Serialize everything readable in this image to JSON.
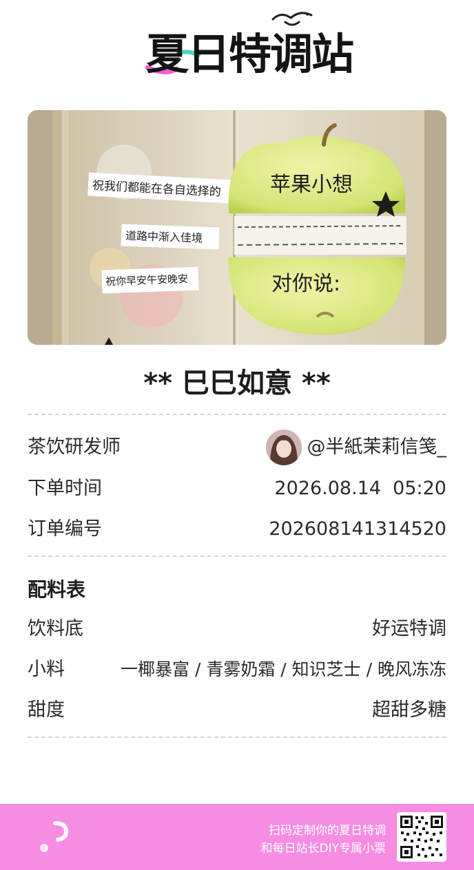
{
  "header": {
    "logo_text": "夏日特调站"
  },
  "hero": {
    "photo_notes": [
      "祝我们都能在各自选择的",
      "道路中渐入佳境",
      "祝你早安午安晚安",
      "苹果小想",
      "对你说:"
    ]
  },
  "drink": {
    "title": "** 巳巳如意 **"
  },
  "order": {
    "creator_label": "茶饮研发师",
    "creator_name": "@半紙茉莉信笺_",
    "time_label": "下单时间",
    "time_value": "2026.08.14  05:20",
    "id_label": "订单编号",
    "id_value": "202608141314520"
  },
  "recipe": {
    "title": "配料表",
    "base_label": "饮料底",
    "base_value": "好运特调",
    "toppings_label": "小料",
    "toppings_value": "一椰暴富 / 青雾奶霜 / 知识芝士 / 晚风冻冻",
    "sweetness_label": "甜度",
    "sweetness_value": "超甜多糖"
  },
  "footer": {
    "line1": "扫码定制你的夏日特调",
    "line2": "和每日站长DIY专属小票"
  },
  "colors": {
    "footer_bg": "#f78de2",
    "accent_pink": "#ef5fd0",
    "accent_teal": "#4fd3c7"
  },
  "icons": {
    "bird": "seagull-icon",
    "footer_mark": "brand-mark-icon",
    "qr": "qr-code-icon"
  }
}
